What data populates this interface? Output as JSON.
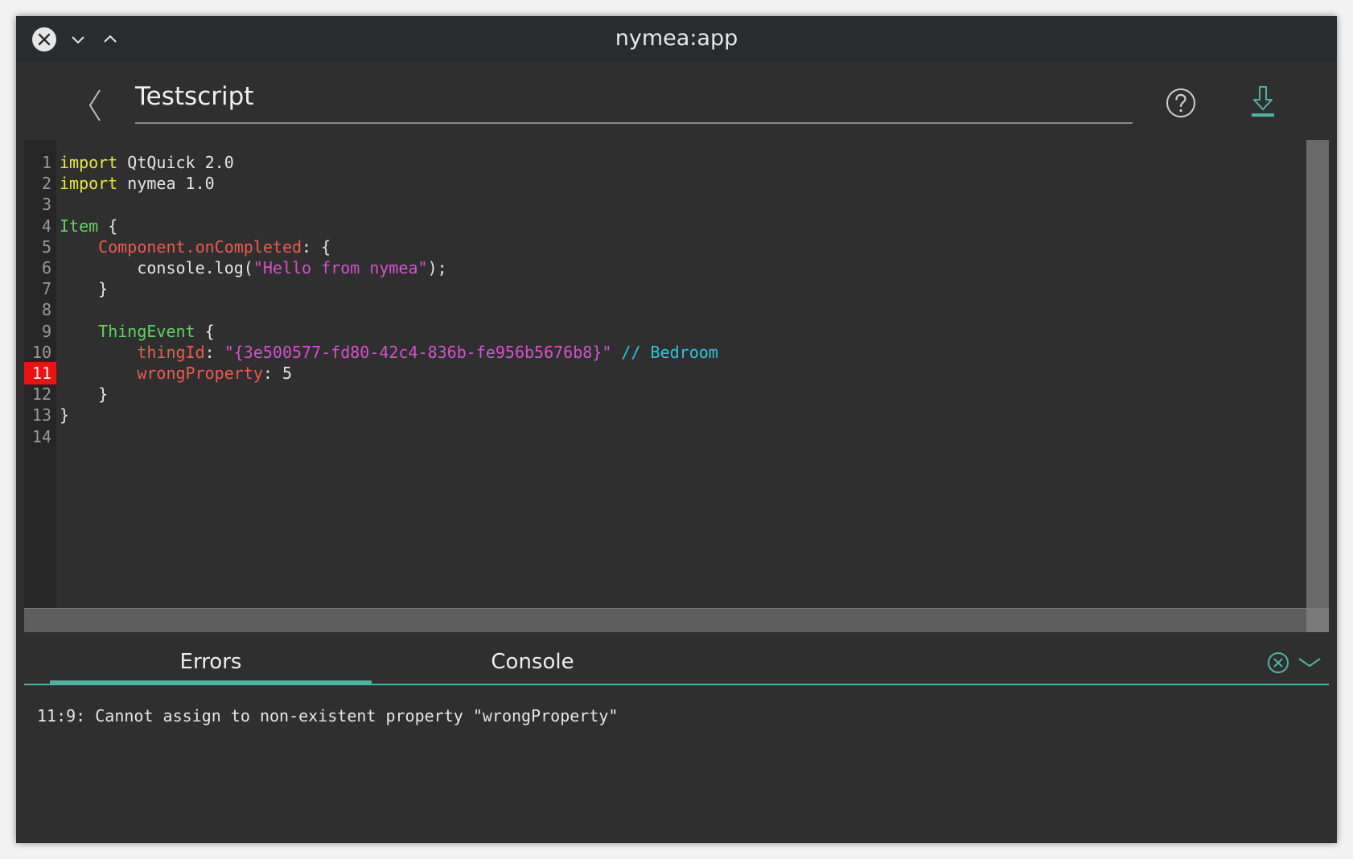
{
  "window": {
    "title": "nymea:app"
  },
  "header": {
    "title": "Testscript"
  },
  "editor": {
    "error_line": "11",
    "line_numbers": [
      "1",
      "2",
      "3",
      "4",
      "5",
      "6",
      "7",
      "8",
      "9",
      "10",
      "11",
      "12",
      "13",
      "14"
    ],
    "lines": [
      [
        {
          "t": "import",
          "c": "kw"
        },
        {
          "t": " QtQuick 2.0",
          "c": ""
        }
      ],
      [
        {
          "t": "import",
          "c": "kw"
        },
        {
          "t": " nymea 1.0",
          "c": ""
        }
      ],
      [],
      [
        {
          "t": "Item",
          "c": "type"
        },
        {
          "t": " {",
          "c": ""
        }
      ],
      [
        {
          "t": "    ",
          "c": ""
        },
        {
          "t": "Component.onCompleted",
          "c": "prop"
        },
        {
          "t": ": {",
          "c": ""
        }
      ],
      [
        {
          "t": "        console.log(",
          "c": ""
        },
        {
          "t": "\"Hello from nymea\"",
          "c": "str"
        },
        {
          "t": ");",
          "c": ""
        }
      ],
      [
        {
          "t": "    }",
          "c": ""
        }
      ],
      [],
      [
        {
          "t": "    ",
          "c": ""
        },
        {
          "t": "ThingEvent",
          "c": "type"
        },
        {
          "t": " {",
          "c": ""
        }
      ],
      [
        {
          "t": "        ",
          "c": ""
        },
        {
          "t": "thingId",
          "c": "prop"
        },
        {
          "t": ": ",
          "c": ""
        },
        {
          "t": "\"{3e500577-fd80-42c4-836b-fe956b5676b8}\"",
          "c": "str"
        },
        {
          "t": " // Bedroom",
          "c": "cmt"
        }
      ],
      [
        {
          "t": "        ",
          "c": ""
        },
        {
          "t": "wrongProperty",
          "c": "prop"
        },
        {
          "t": ": 5",
          "c": ""
        }
      ],
      [
        {
          "t": "    }",
          "c": ""
        }
      ],
      [
        {
          "t": "}",
          "c": ""
        }
      ],
      []
    ]
  },
  "panel": {
    "tabs": [
      {
        "label": "Errors",
        "active": true
      },
      {
        "label": "Console",
        "active": false
      }
    ],
    "errors": [
      "11:9: Cannot assign to non-existent property \"wrongProperty\""
    ]
  },
  "colors": {
    "accent": "#4fb3a3",
    "error": "#ee1111",
    "keyword": "#e8e83a",
    "type": "#5fd45f",
    "property": "#ef5a4f",
    "string": "#d550d0",
    "comment": "#28c8dc"
  },
  "icons": {
    "close": "close-icon",
    "minimize": "chevron-down-icon",
    "maximize": "chevron-up-icon",
    "back": "chevron-left-icon",
    "help": "help-icon",
    "download": "download-icon",
    "clear": "clear-icon",
    "collapse": "chevron-down-icon"
  }
}
